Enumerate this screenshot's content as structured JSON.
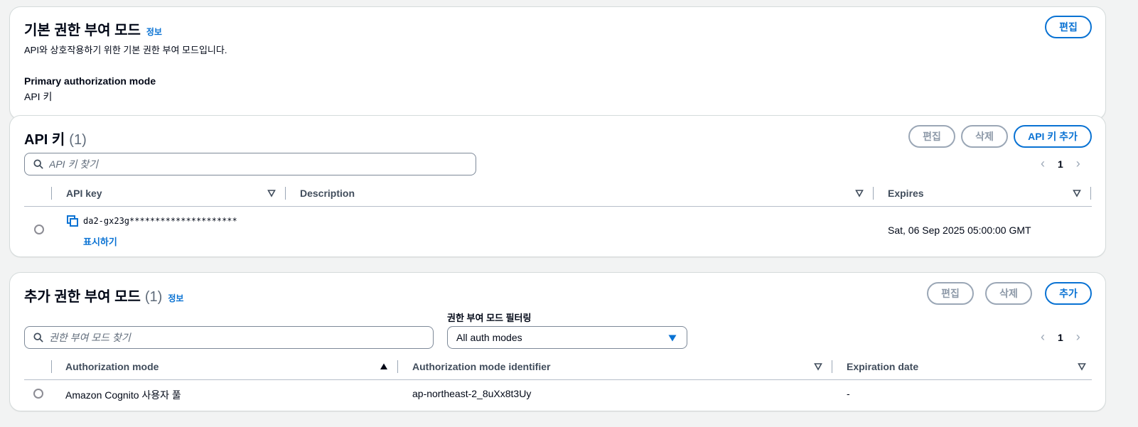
{
  "basic_auth": {
    "title": "기본 권한 부여 모드",
    "info": "정보",
    "description": "API와 상호작용하기 위한 기본 권한 부여 모드입니다.",
    "edit_label": "편집",
    "primary_label": "Primary authorization mode",
    "primary_value": "API 키"
  },
  "api_keys": {
    "title": "API 키",
    "count": "(1)",
    "edit_label": "편집",
    "delete_label": "삭제",
    "add_label": "API 키 추가",
    "search_placeholder": "API 키 찾기",
    "page": "1",
    "columns": [
      "API key",
      "Description",
      "Expires"
    ],
    "rows": [
      {
        "key": "da2-gx23g*********************",
        "show_label": "표시하기",
        "description": "",
        "expires": "Sat, 06 Sep 2025 05:00:00 GMT"
      }
    ]
  },
  "additional_auth": {
    "title": "추가 권한 부여 모드",
    "count": "(1)",
    "info": "정보",
    "edit_label": "편집",
    "delete_label": "삭제",
    "add_label": "추가",
    "search_placeholder": "권한 부여 모드 찾기",
    "filter_label": "권한 부여 모드 필터링",
    "filter_value": "All auth modes",
    "page": "1",
    "columns": [
      "Authorization mode",
      "Authorization mode identifier",
      "Expiration date"
    ],
    "rows": [
      {
        "mode": "Amazon Cognito 사용자 풀",
        "identifier": "ap-northeast-2_8uXx8t3Uy",
        "expiration": "-"
      }
    ]
  },
  "colors": {
    "accent": "#0972d3",
    "disabled": "#8d99a8",
    "heading": "#000716",
    "background": "#f2f3f3"
  }
}
